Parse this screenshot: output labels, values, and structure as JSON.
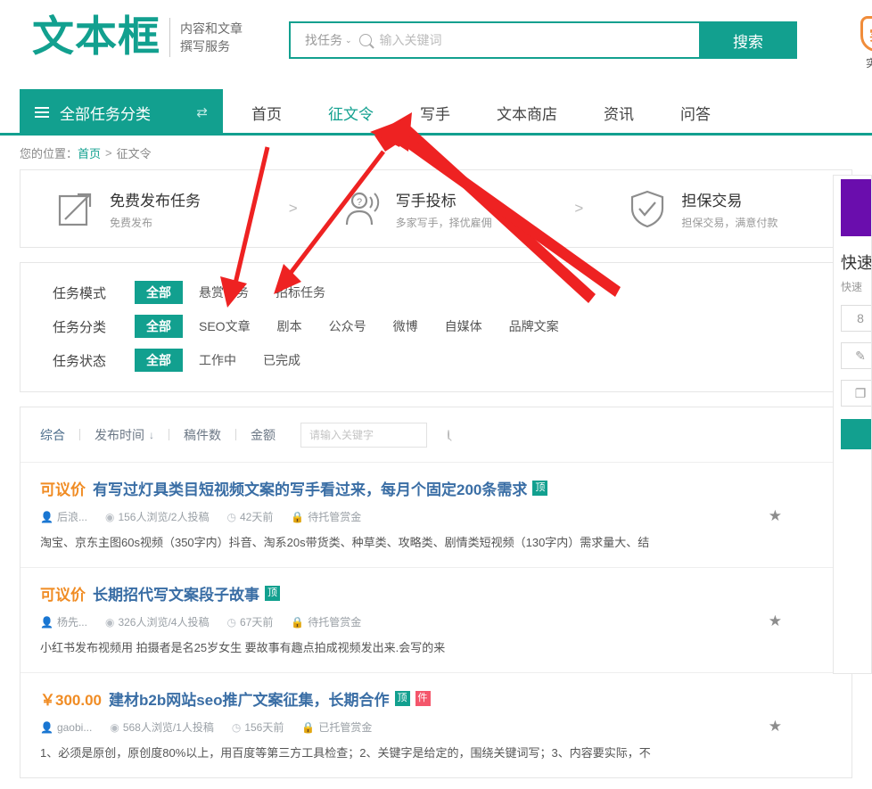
{
  "header": {
    "logo_text": "文本框",
    "logo_sub_line1": "内容和文章",
    "logo_sub_line2": "撰写服务",
    "search_category": "找任务",
    "search_caret": "⌄",
    "search_placeholder": "输入关键词",
    "search_value": "",
    "search_button": "搜索",
    "verify_label": "实名",
    "verify_glyph": "实",
    "accent_color": "#12a08f"
  },
  "nav": {
    "category_button": "全部任务分类",
    "swap_icon": "⇄",
    "links": [
      {
        "label": "首页",
        "active": false
      },
      {
        "label": "征文令",
        "active": true
      },
      {
        "label": "写手",
        "active": false
      },
      {
        "label": "文本商店",
        "active": false
      },
      {
        "label": "资讯",
        "active": false
      },
      {
        "label": "问答",
        "active": false
      }
    ]
  },
  "breadcrumb": {
    "prefix": "您的位置：",
    "home": "首页",
    "separator": ">",
    "current": "征文令"
  },
  "features": [
    {
      "title": "免费发布任务",
      "sub": "免费发布",
      "icon": "external-link-icon"
    },
    {
      "title": "写手投标",
      "sub": "多家写手，择优雇佣",
      "icon": "people-question-icon"
    },
    {
      "title": "担保交易",
      "sub": "担保交易，满意付款",
      "icon": "shield-check-icon"
    }
  ],
  "feature_arrow": ">",
  "filters": [
    {
      "label": "任务模式",
      "options": [
        {
          "label": "全部",
          "active": true
        },
        {
          "label": "悬赏任务",
          "active": false
        },
        {
          "label": "招标任务",
          "active": false
        }
      ]
    },
    {
      "label": "任务分类",
      "options": [
        {
          "label": "全部",
          "active": true
        },
        {
          "label": "SEO文章",
          "active": false
        },
        {
          "label": "剧本",
          "active": false
        },
        {
          "label": "公众号",
          "active": false
        },
        {
          "label": "微博",
          "active": false
        },
        {
          "label": "自媒体",
          "active": false
        },
        {
          "label": "品牌文案",
          "active": false
        }
      ]
    },
    {
      "label": "任务状态",
      "options": [
        {
          "label": "全部",
          "active": true
        },
        {
          "label": "工作中",
          "active": false
        },
        {
          "label": "已完成",
          "active": false
        }
      ]
    }
  ],
  "sortbar": {
    "items": [
      {
        "label": "综合",
        "active": true,
        "arrow": ""
      },
      {
        "label": "发布时间",
        "active": false,
        "arrow": "↓"
      },
      {
        "label": "稿件数",
        "active": false,
        "arrow": ""
      },
      {
        "label": "金额",
        "active": false,
        "arrow": ""
      }
    ],
    "search_placeholder": "请输入关键字",
    "search_value": ""
  },
  "tasks": [
    {
      "price": "可议价",
      "price_type": "negotiable",
      "title": "有写过灯具类目短视频文案的写手看过来，每月个固定200条需求",
      "tags": [
        {
          "text": "顶",
          "color": "teal"
        }
      ],
      "author": "后浪...",
      "views": "156人浏览/2人投稿",
      "time": "42天前",
      "escrow": "待托管赏金",
      "desc": "淘宝、京东主图60s视频（350字内）抖音、淘系20s带货类、种草类、攻略类、剧情类短视频（130字内）需求量大、结"
    },
    {
      "price": "可议价",
      "price_type": "negotiable",
      "title": "长期招代写文案段子故事",
      "tags": [
        {
          "text": "顶",
          "color": "teal"
        }
      ],
      "author": "杨先...",
      "views": "326人浏览/4人投稿",
      "time": "67天前",
      "escrow": "待托管赏金",
      "desc": "小红书发布视频用 拍摄者是名25岁女生 要故事有趣点拍成视频发出来.会写的来"
    },
    {
      "price": "￥300.00",
      "price_type": "fixed",
      "title": "建材b2b网站seo推广文案征集，长期合作",
      "tags": [
        {
          "text": "顶",
          "color": "teal"
        },
        {
          "text": "件",
          "color": "pink"
        }
      ],
      "author": "gaobi...",
      "views": "568人浏览/1人投稿",
      "time": "156天前",
      "escrow": "已托管赏金",
      "desc": "1、必须是原创，原创度80%以上，用百度等第三方工具检查；2、关键字是给定的，围绕关键词写；3、内容要实际，不"
    }
  ],
  "meta_icons": {
    "user": "user-icon",
    "eye": "eye-icon",
    "clock": "clock-icon",
    "lock": "lock-icon",
    "star": "star-icon"
  },
  "rail": {
    "title": "快速",
    "sub": "快速",
    "buttons": [
      "8",
      "✎",
      "❐"
    ]
  },
  "colors": {
    "teal": "#12a08f",
    "orange": "#f08c24",
    "pink": "#f4566b",
    "title_blue": "#3a6ea5"
  }
}
